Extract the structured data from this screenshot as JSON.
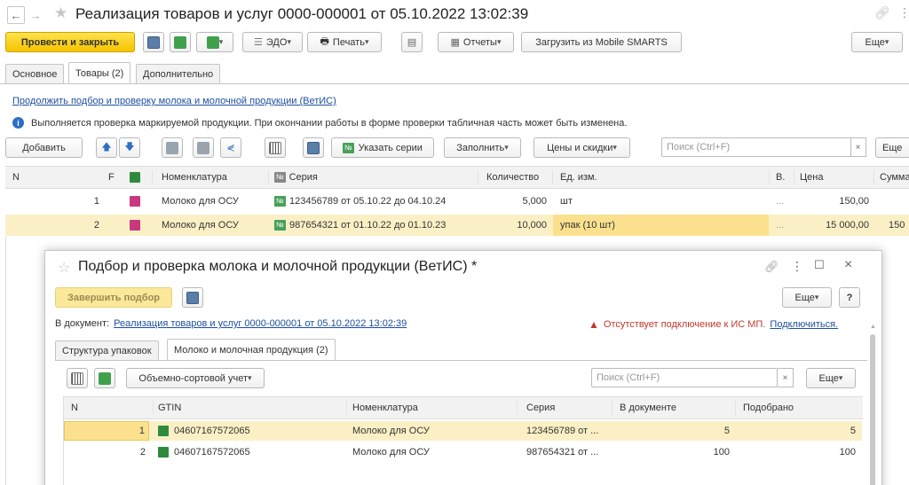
{
  "window": {
    "title": "Реализация товаров и услуг 0000-000001 от 05.10.2022 13:02:39"
  },
  "toolbar": {
    "post_close": "Провести и закрыть",
    "edo": "ЭДО",
    "print": "Печать",
    "reports": "Отчеты",
    "load_mobile": "Загрузить из Mobile SMARTS",
    "more": "Еще"
  },
  "tabs": [
    {
      "label": "Основное"
    },
    {
      "label": "Товары (2)"
    },
    {
      "label": "Дополнительно"
    }
  ],
  "goods": {
    "continue_link": "Продолжить подбор и проверку молока и молочной продукции (ВетИС)",
    "info": "Выполняется проверка маркируемой продукции. При окончании работы в форме проверки табличная часть может быть изменена.",
    "add": "Добавить",
    "set_series": "Указать серии",
    "fill": "Заполнить",
    "prices": "Цены и скидки",
    "search_placeholder": "Поиск (Ctrl+F)",
    "more": "Еще",
    "columns": {
      "n": "N",
      "f": "F",
      "nomenclature": "Номенклатура",
      "series": "Серия",
      "qty": "Количество",
      "unit": "Ед. изм.",
      "v": "В.",
      "price": "Цена",
      "sum": "Сумма"
    },
    "rows": [
      {
        "n": "1",
        "nomenclature": "Молоко для ОСУ",
        "series": "123456789 от 05.10.22 до 04.10.24",
        "qty": "5,000",
        "unit": "шт",
        "v": "...",
        "price": "150,00",
        "sum": ""
      },
      {
        "n": "2",
        "nomenclature": "Молоко для ОСУ",
        "series": "987654321 от 01.10.22 до 01.10.23",
        "qty": "10,000",
        "unit": "упак (10 шт)",
        "v": "...",
        "price": "15 000,00",
        "sum": "150"
      }
    ]
  },
  "dialog": {
    "title": "Подбор и проверка молока и молочной продукции (ВетИС) *",
    "finish": "Завершить подбор",
    "more": "Еще",
    "help": "?",
    "doc_label": "В документ:",
    "doc_link": "Реализация товаров и услуг 0000-000001 от 05.10.2022 13:02:39",
    "warning": "Отсутствует подключение к ИС МП.",
    "connect": "Подключиться.",
    "tabs": [
      {
        "label": "Структура упаковок"
      },
      {
        "label": "Молоко и молочная продукция (2)"
      }
    ],
    "accounting": "Объемно-сортовой учет",
    "search_placeholder": "Поиск (Ctrl+F)",
    "columns": {
      "n": "N",
      "gtin": "GTIN",
      "nomenclature": "Номенклатура",
      "series": "Серия",
      "in_doc": "В документе",
      "picked": "Подобрано"
    },
    "rows": [
      {
        "n": "1",
        "gtin": "04607167572065",
        "nomenclature": "Молоко для ОСУ",
        "series": "123456789 от ...",
        "in_doc": "5",
        "picked": "5"
      },
      {
        "n": "2",
        "gtin": "04607167572065",
        "nomenclature": "Молоко для ОСУ",
        "series": "987654321 от ...",
        "in_doc": "100",
        "picked": "100"
      }
    ]
  }
}
